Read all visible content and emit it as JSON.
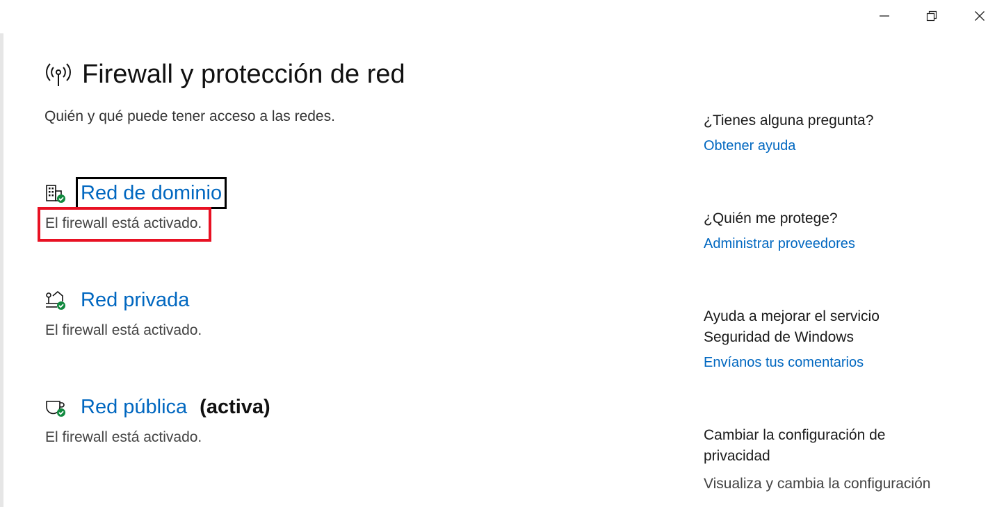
{
  "window": {
    "minimize_label": "Minimizar",
    "maximize_label": "Restaurar",
    "close_label": "Cerrar"
  },
  "header": {
    "title": "Firewall y protección de red",
    "subtitle": "Quién y qué puede tener acceso a las redes."
  },
  "networks": [
    {
      "label": "Red de dominio",
      "status": "El firewall está activado.",
      "icon": "domain-network-icon"
    },
    {
      "label": "Red privada",
      "status": "El firewall está activado.",
      "icon": "private-network-icon"
    },
    {
      "label": "Red pública",
      "active_tag": "(activa)",
      "status": "El firewall está activado.",
      "icon": "public-network-icon"
    }
  ],
  "sidebar": {
    "question_heading": "¿Tienes alguna pregunta?",
    "question_link": "Obtener ayuda",
    "protect_heading": "¿Quién me protege?",
    "protect_link": "Administrar proveedores",
    "improve_heading_1": "Ayuda a mejorar el servicio",
    "improve_heading_2": "Seguridad de Windows",
    "improve_link": "Envíanos tus comentarios",
    "privacy_heading_1": "Cambiar la configuración de",
    "privacy_heading_2": "privacidad",
    "privacy_text": "Visualiza y cambia la configuración"
  },
  "colors": {
    "link": "#0067c0",
    "ok_badge": "#10893e",
    "highlight": "#e81123"
  }
}
